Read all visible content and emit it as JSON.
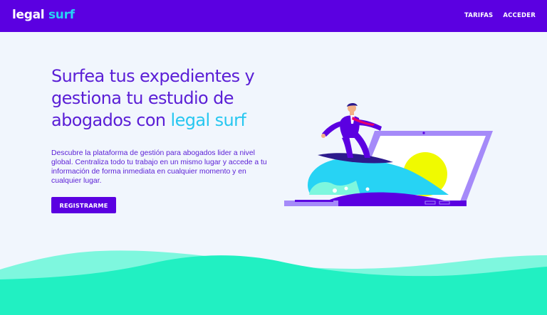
{
  "brand": {
    "name_part1": "legal",
    "name_part2": "surf"
  },
  "nav": {
    "links": [
      {
        "label": "TARIFAS"
      },
      {
        "label": "ACCEDER"
      }
    ]
  },
  "hero": {
    "headline_part1": "Surfea tus expedientes y gestiona tu estudio de abogados con ",
    "headline_accent": "legal surf",
    "description": "Descubre la plataforma de gestión para abogados lider a nivel global. Centraliza todo tu trabajo en un mismo lugar y accede a tu información de forma inmediata en cualquier momento y en cualquier lugar.",
    "cta_label": "REGISTRARME"
  },
  "colors": {
    "primary": "#5b00e1",
    "accent": "#27d3f4",
    "background": "#f1f6fd",
    "wave_front": "#21f0c2",
    "wave_back": "#7ef7de"
  }
}
